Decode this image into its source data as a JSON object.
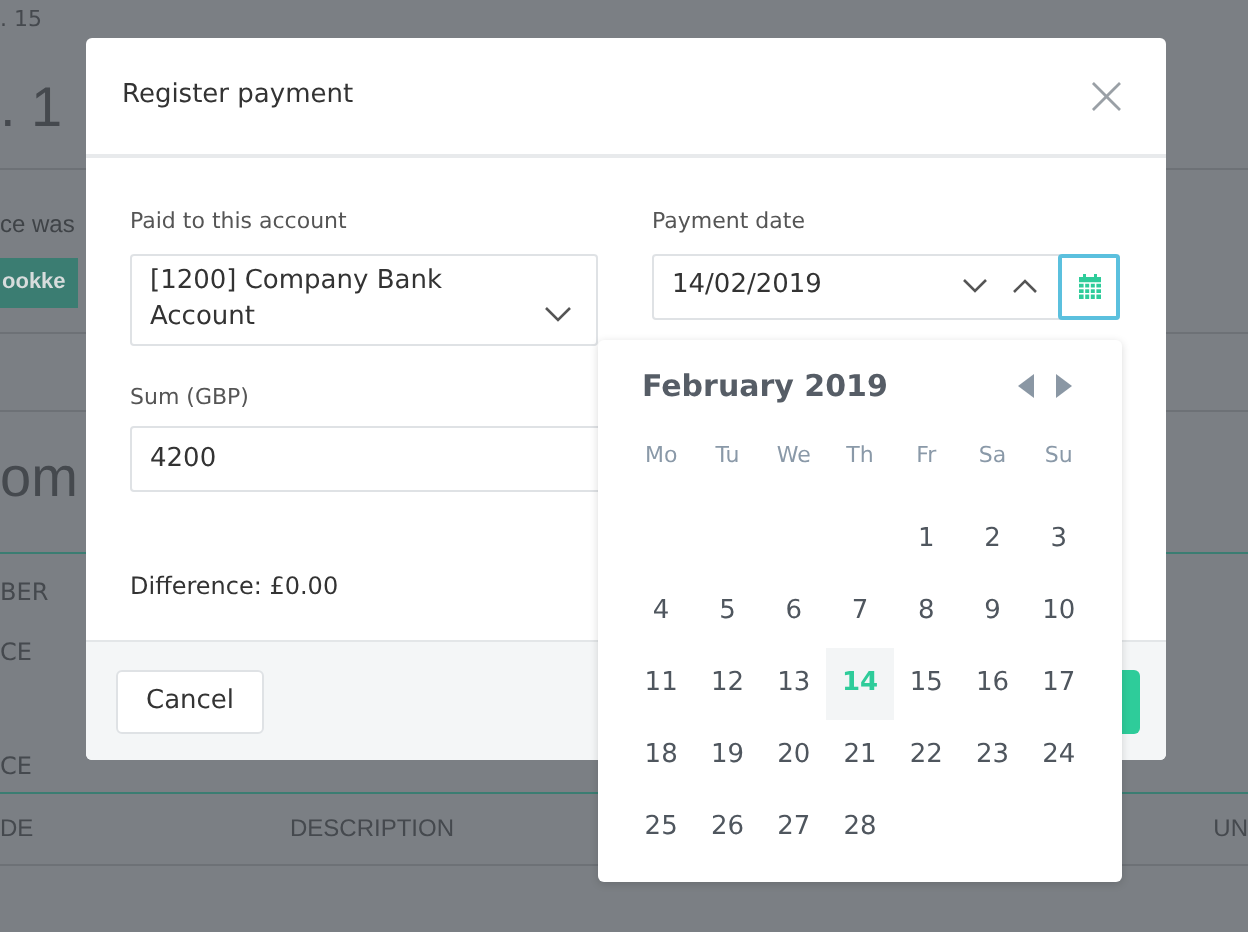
{
  "background": {
    "breadcrumb": ". 15",
    "heading": ". 1",
    "notice": "ce was",
    "badge": "ookke",
    "section_heading": "om",
    "labels": [
      "BER",
      "CE",
      "CE"
    ],
    "table_columns": [
      "DE",
      "DESCRIPTION",
      "UN"
    ]
  },
  "dialog": {
    "title": "Register payment",
    "close": "×",
    "account": {
      "label": "Paid to this account",
      "value": "[1200] Company Bank Account"
    },
    "sum": {
      "label": "Sum (GBP)",
      "value": "4200"
    },
    "difference": "Difference: £0.00",
    "date": {
      "label": "Payment date",
      "value": "14/02/2019"
    },
    "cancel": "Cancel"
  },
  "calendar": {
    "month": "February 2019",
    "weekdays": [
      "Mo",
      "Tu",
      "We",
      "Th",
      "Fr",
      "Sa",
      "Su"
    ],
    "weeks": [
      [
        {
          "kind": "blank"
        },
        {
          "kind": "blank"
        },
        {
          "kind": "blank"
        },
        {
          "kind": "blank"
        },
        {
          "kind": "day",
          "day": "1",
          "selected": false
        },
        {
          "kind": "day",
          "day": "2",
          "selected": false
        },
        {
          "kind": "day",
          "day": "3",
          "selected": false
        }
      ],
      [
        {
          "kind": "day",
          "day": "4",
          "selected": false
        },
        {
          "kind": "day",
          "day": "5",
          "selected": false
        },
        {
          "kind": "day",
          "day": "6",
          "selected": false
        },
        {
          "kind": "day",
          "day": "7",
          "selected": false
        },
        {
          "kind": "day",
          "day": "8",
          "selected": false
        },
        {
          "kind": "day",
          "day": "9",
          "selected": false
        },
        {
          "kind": "day",
          "day": "10",
          "selected": false
        }
      ],
      [
        {
          "kind": "day",
          "day": "11",
          "selected": false
        },
        {
          "kind": "day",
          "day": "12",
          "selected": false
        },
        {
          "kind": "day",
          "day": "13",
          "selected": false
        },
        {
          "kind": "day",
          "day": "14",
          "selected": true
        },
        {
          "kind": "day",
          "day": "15",
          "selected": false
        },
        {
          "kind": "day",
          "day": "16",
          "selected": false
        },
        {
          "kind": "day",
          "day": "17",
          "selected": false
        }
      ],
      [
        {
          "kind": "day",
          "day": "18",
          "selected": false
        },
        {
          "kind": "day",
          "day": "19",
          "selected": false
        },
        {
          "kind": "day",
          "day": "20",
          "selected": false
        },
        {
          "kind": "day",
          "day": "21",
          "selected": false
        },
        {
          "kind": "day",
          "day": "22",
          "selected": false
        },
        {
          "kind": "day",
          "day": "23",
          "selected": false
        },
        {
          "kind": "day",
          "day": "24",
          "selected": false
        }
      ],
      [
        {
          "kind": "day",
          "day": "25",
          "selected": false
        },
        {
          "kind": "day",
          "day": "26",
          "selected": false
        },
        {
          "kind": "day",
          "day": "27",
          "selected": false
        },
        {
          "kind": "day",
          "day": "28",
          "selected": false
        }
      ]
    ]
  }
}
